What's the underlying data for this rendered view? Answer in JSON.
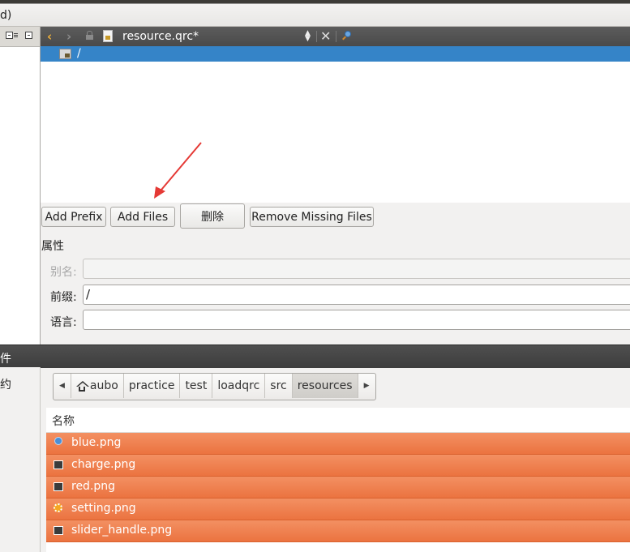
{
  "menubar": {
    "fragment": "d)"
  },
  "editor": {
    "file_name": "resource.qrc*",
    "tree": {
      "items": [
        {
          "label": "/"
        }
      ]
    }
  },
  "buttons": {
    "add_prefix": "Add Prefix",
    "add_files": "Add Files",
    "delete": "删除",
    "remove_missing": "Remove Missing Files"
  },
  "properties": {
    "title": "属性",
    "alias_label": "别名:",
    "alias_value": "",
    "prefix_label": "前缀:",
    "prefix_value": "/",
    "language_label": "语言:",
    "language_value": ""
  },
  "panel": {
    "title": "件",
    "left_label": "约"
  },
  "file_browser": {
    "path": [
      "aubo",
      "practice",
      "test",
      "loadqrc",
      "src",
      "resources"
    ],
    "column_header": "名称",
    "files": [
      {
        "name": "blue.png",
        "icon": "blue-dot-icon"
      },
      {
        "name": "charge.png",
        "icon": "image-icon"
      },
      {
        "name": "red.png",
        "icon": "image-icon"
      },
      {
        "name": "setting.png",
        "icon": "gear-icon"
      },
      {
        "name": "slider_handle.png",
        "icon": "image-icon"
      }
    ]
  },
  "colors": {
    "selection_blue": "#3584c8",
    "selection_orange": "#ef7f4e",
    "toolbar_dark": "#4f4f4f",
    "annotation_red": "#e53935"
  }
}
